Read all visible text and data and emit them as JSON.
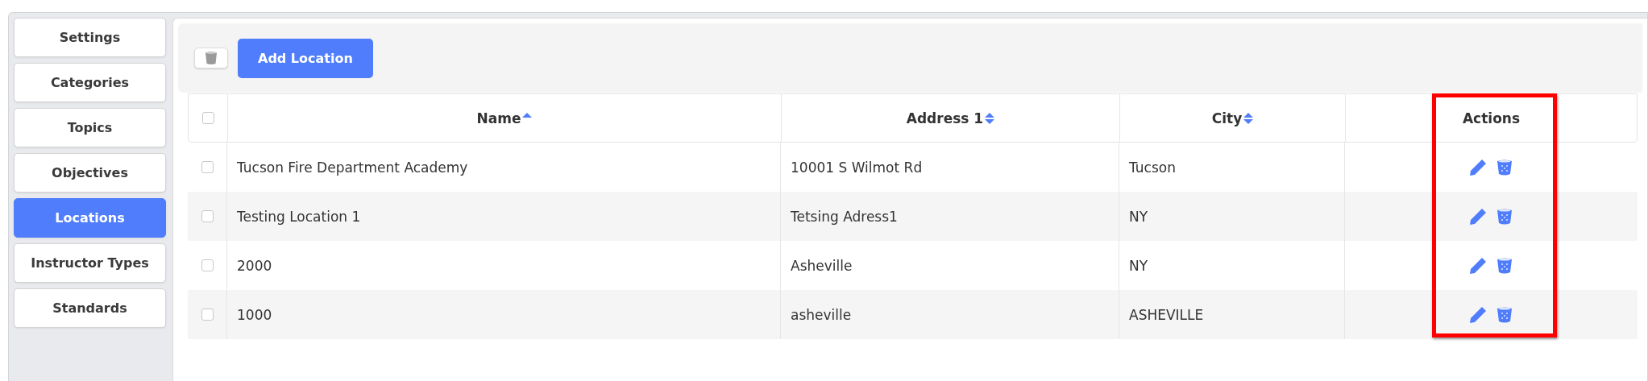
{
  "sidebar": {
    "items": [
      {
        "label": "Settings",
        "selected": false
      },
      {
        "label": "Categories",
        "selected": false
      },
      {
        "label": "Topics",
        "selected": false
      },
      {
        "label": "Objectives",
        "selected": false
      },
      {
        "label": "Locations",
        "selected": true
      },
      {
        "label": "Instructor Types",
        "selected": false
      },
      {
        "label": "Standards",
        "selected": false
      }
    ]
  },
  "toolbar": {
    "add_button": "Add Location"
  },
  "table": {
    "select_all_checked": false,
    "columns": [
      {
        "label": "Name",
        "sortable": true,
        "sorted_ascending": true
      },
      {
        "label": "Address 1",
        "sortable": true,
        "sorted_ascending": false
      },
      {
        "label": "City",
        "sortable": true,
        "sorted_ascending": false
      },
      {
        "label": "Actions",
        "sortable": false
      }
    ],
    "rows": [
      {
        "checked": false,
        "cells": [
          "Tucson Fire Department Academy",
          "10001 S Wilmot Rd",
          "Tucson"
        ]
      },
      {
        "checked": false,
        "cells": [
          "Testing Location 1",
          "Tetsing Adress1",
          "NY"
        ]
      },
      {
        "checked": false,
        "cells": [
          "2000",
          "Asheville",
          "NY"
        ]
      },
      {
        "checked": false,
        "cells": [
          "1000",
          "asheville",
          "ASHEVILLE"
        ]
      }
    ]
  }
}
